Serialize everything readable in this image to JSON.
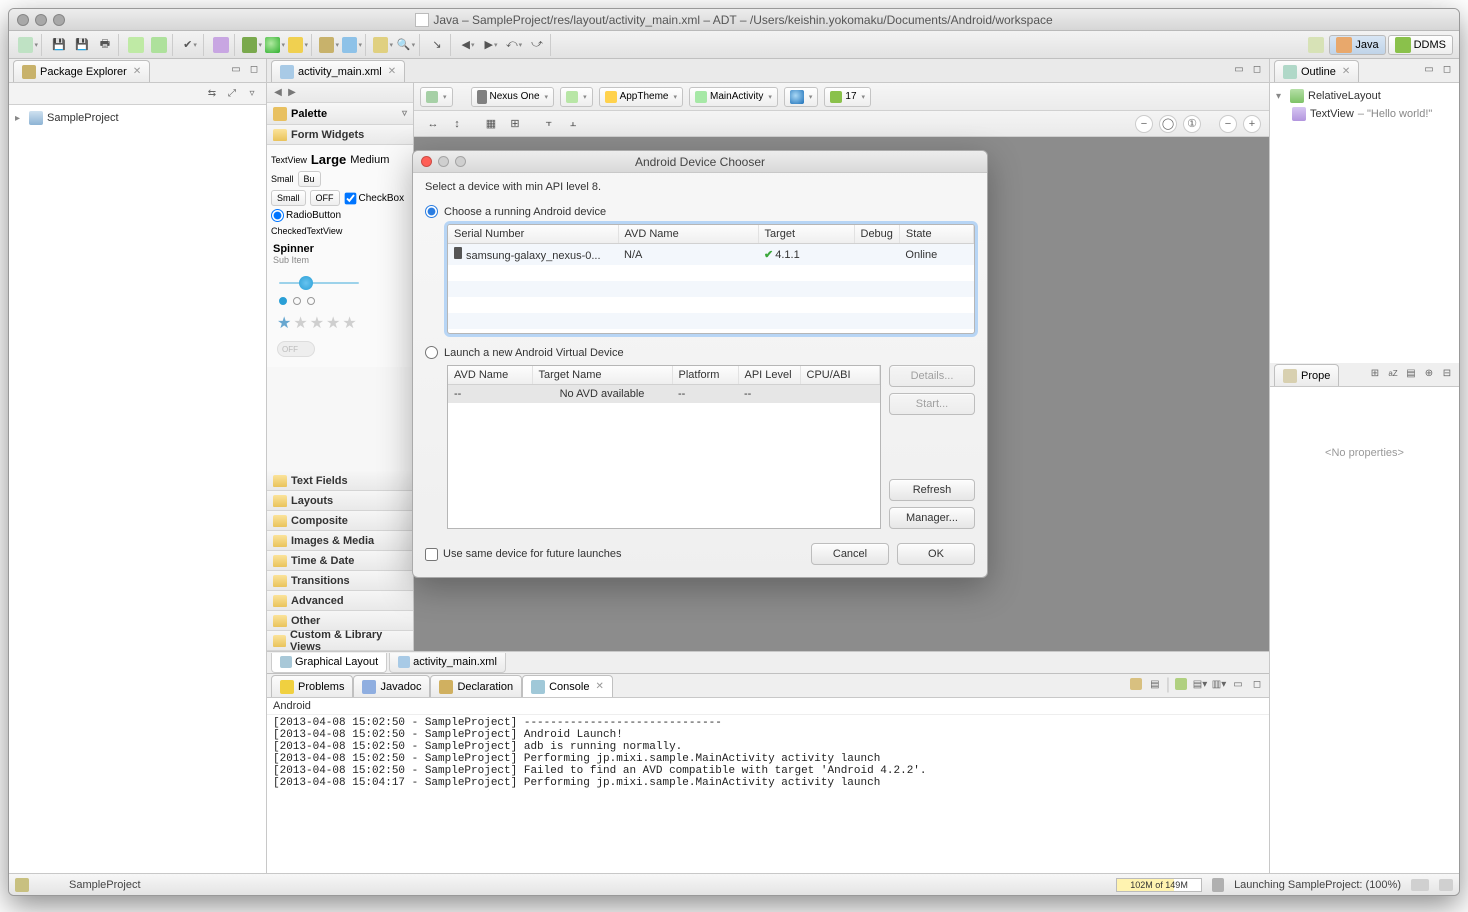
{
  "window": {
    "title": "Java – SampleProject/res/layout/activity_main.xml – ADT – /Users/keishin.yokomaku/Documents/Android/workspace"
  },
  "perspectives": {
    "java": "Java",
    "ddms": "DDMS"
  },
  "package_explorer": {
    "title": "Package Explorer",
    "project": "SampleProject"
  },
  "editor": {
    "tab": "activity_main.xml",
    "subtabs": {
      "graphical": "Graphical Layout",
      "xml": "activity_main.xml"
    },
    "config": {
      "device": "Nexus One",
      "theme": "AppTheme",
      "activity": "MainActivity",
      "api": "17"
    }
  },
  "palette": {
    "title": "Palette",
    "form_widgets": "Form Widgets",
    "textview_sizes": {
      "tv": "TextView",
      "large": "Large",
      "medium": "Medium",
      "small": "Small",
      "bu": "Bu"
    },
    "buttons": {
      "small": "Small",
      "off": "OFF",
      "checkbox": "CheckBox"
    },
    "radio": {
      "rb": "RadioButton",
      "ctv": "CheckedTextView"
    },
    "spinner": "Spinner",
    "subitem": "Sub Item",
    "switch_off": "OFF",
    "categories": [
      "Text Fields",
      "Layouts",
      "Composite",
      "Images & Media",
      "Time & Date",
      "Transitions",
      "Advanced",
      "Other",
      "Custom & Library Views"
    ]
  },
  "outline": {
    "title": "Outline",
    "root": "RelativeLayout",
    "child": "TextView",
    "child_text": "– \"Hello world!\""
  },
  "properties": {
    "title": "Prope",
    "empty": "<No properties>"
  },
  "bottom_tabs": {
    "problems": "Problems",
    "javadoc": "Javadoc",
    "declaration": "Declaration",
    "console": "Console"
  },
  "console": {
    "source": "Android",
    "lines": [
      "[2013-04-08 15:02:50 - SampleProject] ------------------------------",
      "[2013-04-08 15:02:50 - SampleProject] Android Launch!",
      "[2013-04-08 15:02:50 - SampleProject] adb is running normally.",
      "[2013-04-08 15:02:50 - SampleProject] Performing jp.mixi.sample.MainActivity activity launch",
      "[2013-04-08 15:02:50 - SampleProject] Failed to find an AVD compatible with target 'Android 4.2.2'.",
      "[2013-04-08 15:04:17 - SampleProject] Performing jp.mixi.sample.MainActivity activity launch"
    ]
  },
  "status": {
    "left_prefix": "SampleProject",
    "memory": "102M of 149M",
    "launch": "Launching SampleProject: (100%)"
  },
  "chooser": {
    "title": "Android Device Chooser",
    "msg": "Select a device with min API level 8.",
    "choose_running": "Choose a running Android device",
    "launch_avd": "Launch a new Android Virtual Device",
    "running_cols": {
      "serial": "Serial Number",
      "avd": "AVD Name",
      "target": "Target",
      "debug": "Debug",
      "state": "State"
    },
    "running_row": {
      "serial": "samsung-galaxy_nexus-0...",
      "avd": "N/A",
      "target": "4.1.1",
      "debug": "",
      "state": "Online"
    },
    "avd_cols": {
      "name": "AVD Name",
      "target": "Target Name",
      "platform": "Platform",
      "api": "API Level",
      "cpu": "CPU/ABI"
    },
    "avd_row": {
      "name": "--",
      "target": "No AVD available",
      "platform": "--",
      "api": "--",
      "cpu": ""
    },
    "btns": {
      "details": "Details...",
      "start": "Start...",
      "refresh": "Refresh",
      "manager": "Manager..."
    },
    "use_same": "Use same device for future launches",
    "cancel": "Cancel",
    "ok": "OK"
  }
}
